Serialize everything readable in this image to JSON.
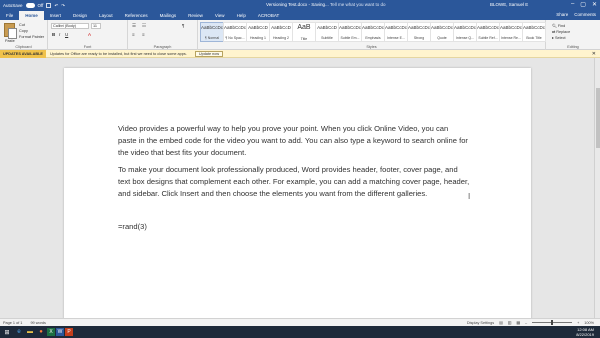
{
  "titlebar": {
    "autosave": "AutoSave",
    "autosave_state": "Off",
    "doc_title": "Versioning Test.docx - Saving...",
    "search_hint": "Tell me what you want to do",
    "user": "BLOWE, Samuel E"
  },
  "tabs": [
    "File",
    "Home",
    "Insert",
    "Design",
    "Layout",
    "References",
    "Mailings",
    "Review",
    "View",
    "Help",
    "ACROBAT"
  ],
  "tabs_right": {
    "share": "Share",
    "comments": "Comments"
  },
  "ribbon": {
    "clipboard": {
      "label": "Clipboard",
      "paste": "Paste",
      "cut": "Cut",
      "copy": "Copy",
      "format_painter": "Format Painter"
    },
    "font": {
      "label": "Font",
      "family": "Calibri (Body)",
      "size": "11"
    },
    "paragraph": {
      "label": "Paragraph"
    },
    "styles": {
      "label": "Styles",
      "items": [
        {
          "sample": "AaBbCcDc",
          "name": "¶ Normal"
        },
        {
          "sample": "AaBbCcDc",
          "name": "¶ No Spac..."
        },
        {
          "sample": "AaBbCcD",
          "name": "Heading 1"
        },
        {
          "sample": "AaBbCcD",
          "name": "Heading 2"
        },
        {
          "sample": "AaB",
          "name": "Title"
        },
        {
          "sample": "AaBbCcD",
          "name": "Subtitle"
        },
        {
          "sample": "AaBbCcDc",
          "name": "Subtle Em..."
        },
        {
          "sample": "AaBbCcDc",
          "name": "Emphasis"
        },
        {
          "sample": "AaBbCcDc",
          "name": "Intense E..."
        },
        {
          "sample": "AaBbCcDc",
          "name": "Strong"
        },
        {
          "sample": "AaBbCcDc",
          "name": "Quote"
        },
        {
          "sample": "AaBbCcDc",
          "name": "Intense Q..."
        },
        {
          "sample": "AaBbCcDc",
          "name": "Subtle Ref..."
        },
        {
          "sample": "AaBbCcDc",
          "name": "Intense Re..."
        },
        {
          "sample": "AaBbCcDc",
          "name": "Book Title"
        }
      ]
    },
    "editing": {
      "label": "Editing",
      "find": "Find",
      "replace": "Replace",
      "select": "Select"
    }
  },
  "notice": {
    "badge": "UPDATES AVAILABLE",
    "message": "Updates for Office are ready to be installed, but first we need to close some apps.",
    "button": "Update now"
  },
  "document": {
    "paragraphs": [
      "Video provides a powerful way to help you prove your point. When you click Online Video, you can",
      "paste in the embed code for the video you want to add. You can also type a keyword to search online for",
      "the video that best fits your document.",
      "To make your document look professionally produced, Word provides header, footer, cover page, and",
      "text box designs that complement each other. For example, you can add a matching cover page, header,",
      "and sidebar. Click Insert and then choose the elements you want from the different galleries.",
      "=rand(3)"
    ]
  },
  "status": {
    "page": "Page 1 of 1",
    "words": "99 words",
    "display_settings": "Display Settings",
    "zoom": "100%"
  },
  "taskbar": {
    "time": "12:08 AM",
    "date": "8/22/2019"
  }
}
